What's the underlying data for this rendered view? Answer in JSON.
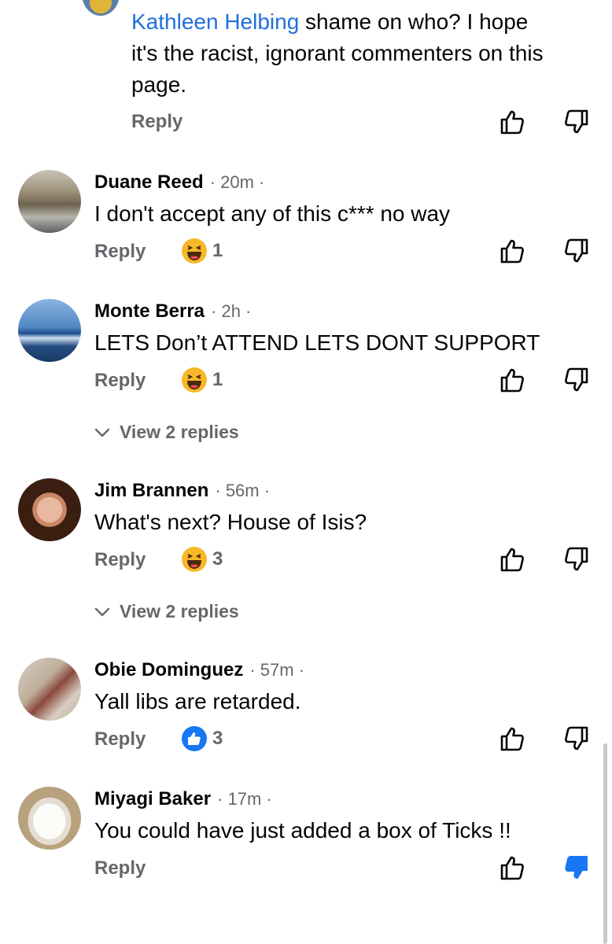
{
  "top_reply": {
    "mention": "Kathleen Helbing",
    "line1_rest": " shame on who?  I hope",
    "line2": "it's the racist, ignorant commenters on this",
    "line3": "page.",
    "reply_label": "Reply"
  },
  "comments": [
    {
      "author": "Duane Reed",
      "time": "· 20m ·",
      "text": "I don't accept any of this c*** no way",
      "reply_label": "Reply",
      "reaction_icon": "haha-emoji-icon",
      "reaction_count": "1"
    },
    {
      "author": "Monte Berra",
      "time": "· 2h ·",
      "text": "LETS Don’t ATTEND LETS DONT SUPPORT",
      "reply_label": "Reply",
      "reaction_icon": "haha-emoji-icon",
      "reaction_count": "1",
      "view_replies": "View 2 replies"
    },
    {
      "author": "Jim Brannen",
      "time": "· 56m ·",
      "text": "What's next? House of Isis?",
      "reply_label": "Reply",
      "reaction_icon": "haha-emoji-icon",
      "reaction_count": "3",
      "view_replies": "View 2 replies"
    },
    {
      "author": "Obie Dominguez",
      "time": "· 57m ·",
      "text": "Yall libs are retarded.",
      "reply_label": "Reply",
      "reaction_icon": "like-icon",
      "reaction_count": "3"
    },
    {
      "author": "Miyagi Baker",
      "time": "· 17m ·",
      "text": "You could have just added a box of Ticks !!",
      "reply_label": "Reply",
      "downvote_active": true
    }
  ],
  "colors": {
    "link_blue": "#216fdb",
    "secondary_text": "#65676b",
    "active_downvote": "#1877f2",
    "haha_yellow": "#f7b928"
  }
}
